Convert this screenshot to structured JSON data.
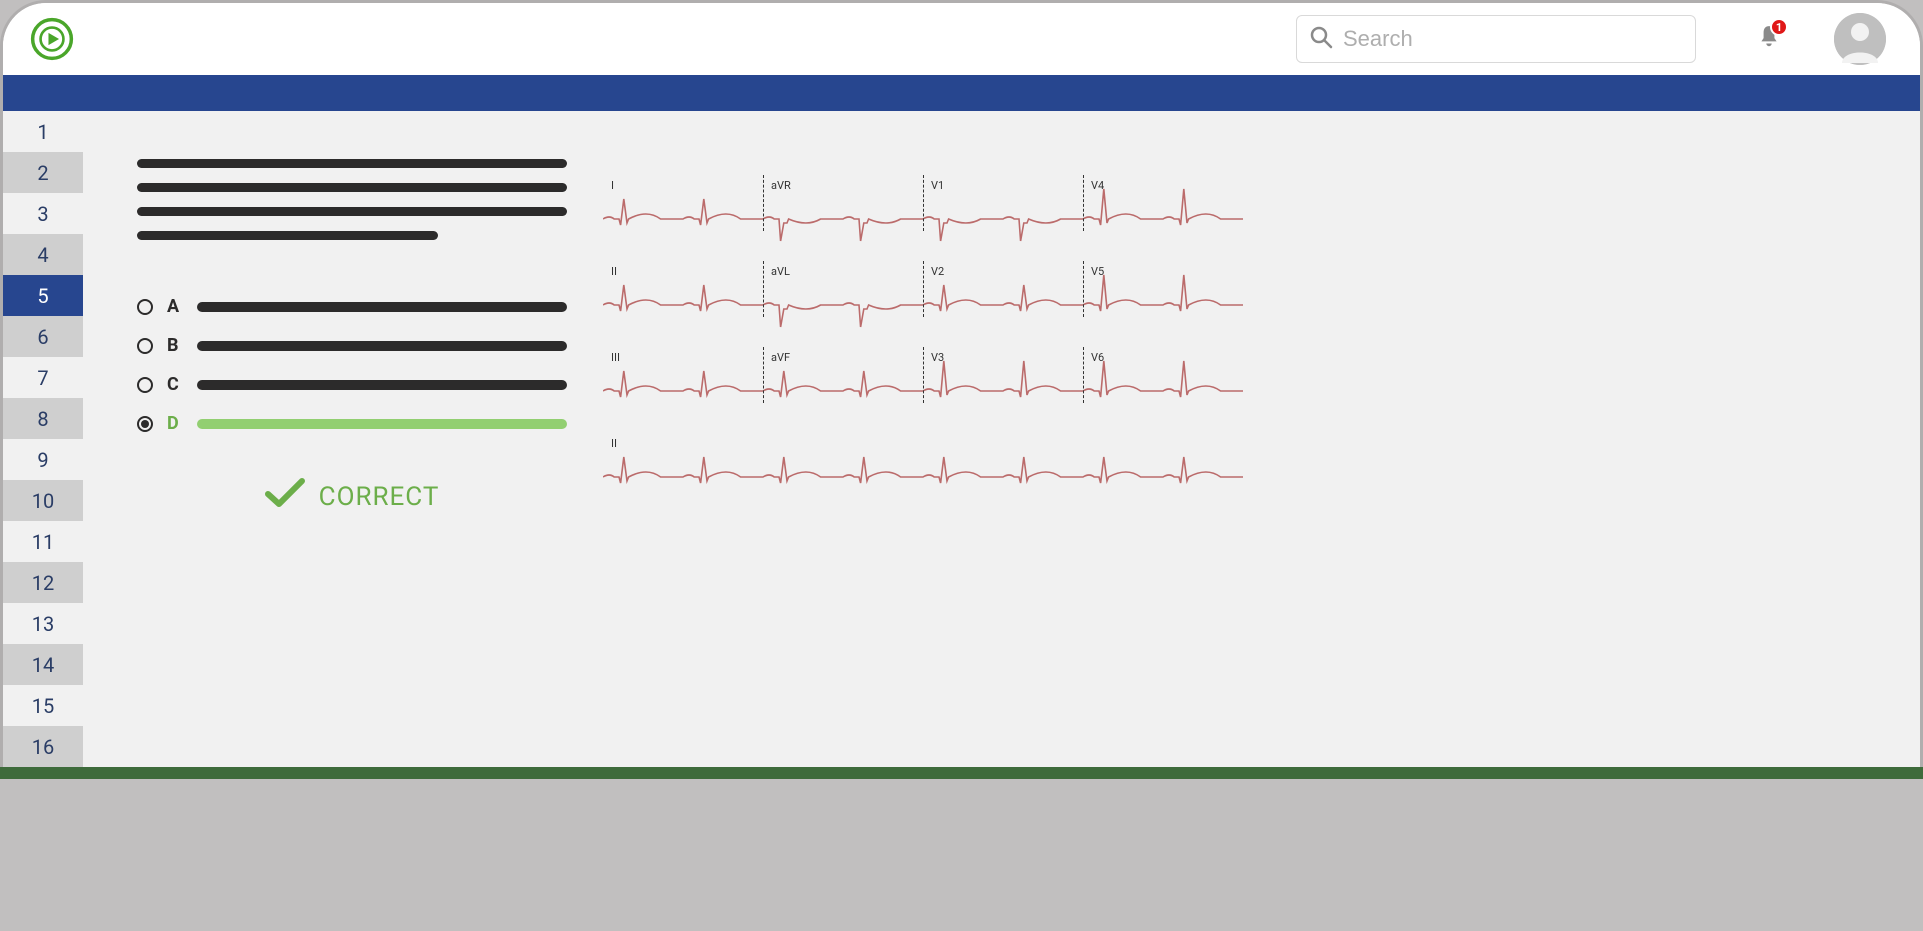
{
  "header": {
    "search_placeholder": "Search",
    "notification_count": "1"
  },
  "colors": {
    "brand_blue": "#27468f",
    "correct_green": "#6cae4a",
    "brand_green": "#4aa62a"
  },
  "question_nav": {
    "items": [
      "1",
      "2",
      "3",
      "4",
      "5",
      "6",
      "7",
      "8",
      "9",
      "10",
      "11",
      "12",
      "13",
      "14",
      "15",
      "16"
    ],
    "active_index": 4
  },
  "answers": {
    "options": [
      {
        "letter": "A",
        "selected": false,
        "correct": false
      },
      {
        "letter": "B",
        "selected": false,
        "correct": false
      },
      {
        "letter": "C",
        "selected": false,
        "correct": false
      },
      {
        "letter": "D",
        "selected": true,
        "correct": true
      }
    ]
  },
  "result_label": "CORRECT",
  "ecg": {
    "rows": [
      {
        "leads": [
          "I",
          "aVR",
          "V1",
          "V4"
        ]
      },
      {
        "leads": [
          "II",
          "aVL",
          "V2",
          "V5"
        ]
      },
      {
        "leads": [
          "III",
          "aVF",
          "V3",
          "V6"
        ]
      },
      {
        "leads": [
          "II"
        ]
      }
    ]
  }
}
